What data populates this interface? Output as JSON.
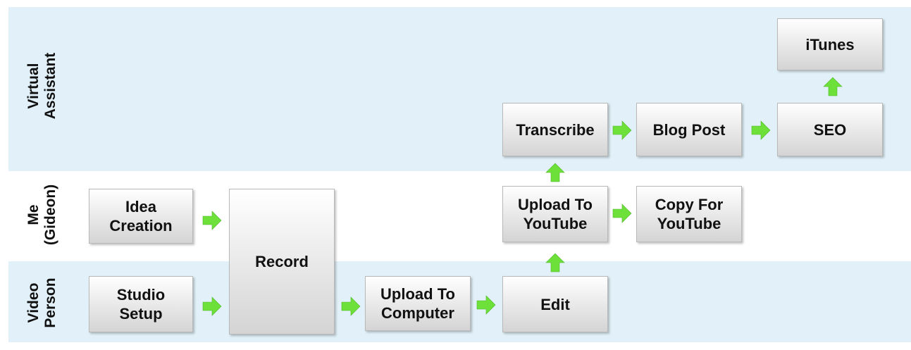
{
  "lanes": {
    "virtual_assistant": [
      "Virtual",
      "Assistant"
    ],
    "me": [
      "Me",
      "(Gideon)"
    ],
    "video_person": [
      "Video",
      "Person"
    ]
  },
  "boxes": {
    "itunes": [
      "iTunes"
    ],
    "transcribe": [
      "Transcribe"
    ],
    "blog_post": [
      "Blog Post"
    ],
    "seo": [
      "SEO"
    ],
    "idea_creation": [
      "Idea",
      "Creation"
    ],
    "record": [
      "Record"
    ],
    "upload_youtube": [
      "Upload To",
      "YouTube"
    ],
    "copy_youtube": [
      "Copy For",
      "YouTube"
    ],
    "studio_setup": [
      "Studio",
      "Setup"
    ],
    "upload_computer": [
      "Upload To",
      "Computer"
    ],
    "edit": [
      "Edit"
    ]
  },
  "colors": {
    "lane_fill": "#e2f1f9",
    "arrow_green": "#6ee03a",
    "box_border": "#b9b9b9"
  },
  "icons": {
    "arrow": "green-arrow-icon"
  }
}
